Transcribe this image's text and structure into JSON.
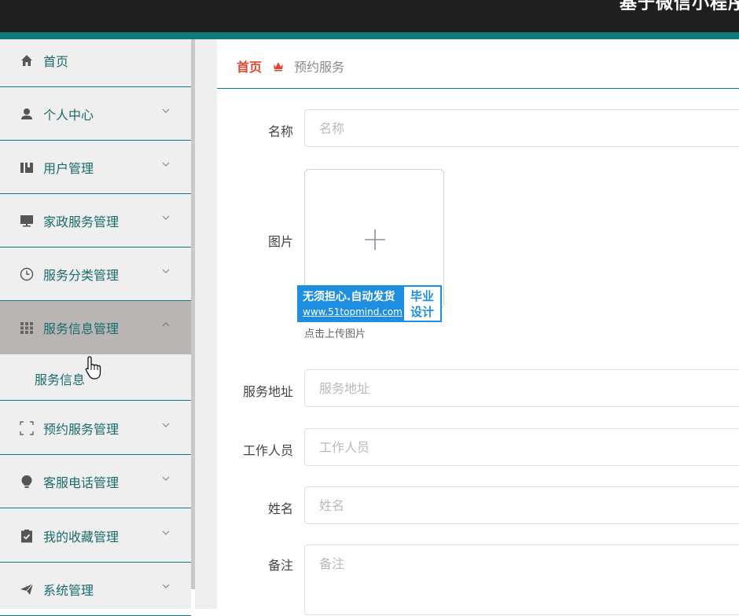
{
  "header": {
    "title": "基于微信小程序"
  },
  "sidebar": {
    "items": [
      {
        "label": "首页",
        "icon": "home-icon"
      },
      {
        "label": "个人中心",
        "icon": "user-icon"
      },
      {
        "label": "用户管理",
        "icon": "users-icon"
      },
      {
        "label": "家政服务管理",
        "icon": "monitor-icon"
      },
      {
        "label": "服务分类管理",
        "icon": "clock-icon"
      },
      {
        "label": "服务信息管理",
        "icon": "grid-icon"
      },
      {
        "label": "预约服务管理",
        "icon": "frame-icon"
      },
      {
        "label": "客服电话管理",
        "icon": "bulb-icon"
      },
      {
        "label": "我的收藏管理",
        "icon": "clipboard-icon"
      },
      {
        "label": "系统管理",
        "icon": "send-icon"
      }
    ],
    "submenu": {
      "label": "服务信息"
    }
  },
  "breadcrumb": {
    "home": "首页",
    "current": "预约服务"
  },
  "form": {
    "name": {
      "label": "名称",
      "placeholder": "名称"
    },
    "image": {
      "label": "图片",
      "tip": "点击上传图片"
    },
    "address": {
      "label": "服务地址",
      "placeholder": "服务地址"
    },
    "worker": {
      "label": "工作人员",
      "placeholder": "工作人员"
    },
    "person": {
      "label": "姓名",
      "placeholder": "姓名"
    },
    "remark": {
      "label": "备注",
      "placeholder": "备注"
    }
  },
  "watermark": {
    "line1": "无须担心.自动发货",
    "line2": "www.51topmind.com",
    "right1": "毕业",
    "right2": "设计"
  },
  "colors": {
    "accent": "#0e7a7a",
    "topbar": "#1f1f1f",
    "crumb_home": "#e0472e",
    "watermark": "#1e8fe0"
  }
}
